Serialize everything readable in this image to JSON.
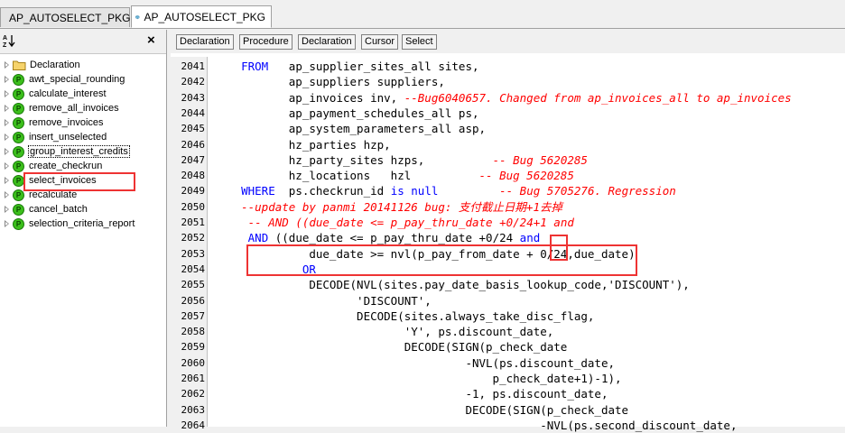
{
  "tabs": [
    {
      "label": "AP_AUTOSELECT_PKG",
      "active": false
    },
    {
      "label": "AP_AUTOSELECT_PKG",
      "active": true
    }
  ],
  "left": {
    "sort_icon": "sort-az-icon",
    "close_glyph": "×",
    "items": [
      {
        "label": "Declaration",
        "icon": "folder-icon"
      },
      {
        "label": "awt_special_rounding",
        "icon": "procedure-icon"
      },
      {
        "label": "calculate_interest",
        "icon": "procedure-icon"
      },
      {
        "label": "remove_all_invoices",
        "icon": "procedure-icon"
      },
      {
        "label": "remove_invoices",
        "icon": "procedure-icon"
      },
      {
        "label": "insert_unselected",
        "icon": "procedure-icon"
      },
      {
        "label": "group_interest_credits",
        "icon": "procedure-icon"
      },
      {
        "label": "create_checkrun",
        "icon": "procedure-icon"
      },
      {
        "label": "select_invoices",
        "icon": "procedure-icon"
      },
      {
        "label": "recalculate",
        "icon": "procedure-icon"
      },
      {
        "label": "cancel_batch",
        "icon": "procedure-icon"
      },
      {
        "label": "selection_criteria_report",
        "icon": "procedure-icon"
      }
    ],
    "procedure_glyph": "P"
  },
  "toolbar": {
    "buttons": [
      "Declaration",
      "Procedure",
      "Declaration",
      "Cursor",
      "Select"
    ]
  },
  "editor": {
    "lines": [
      {
        "n": "2041",
        "parts": [
          [
            "    ",
            "tx"
          ],
          [
            "FROM",
            "kw"
          ],
          [
            "   ap_supplier_sites_all sites,",
            "tx"
          ]
        ]
      },
      {
        "n": "2042",
        "parts": [
          [
            "           ap_suppliers suppliers,",
            "tx"
          ]
        ]
      },
      {
        "n": "2043",
        "parts": [
          [
            "           ap_invoices inv, ",
            "tx"
          ],
          [
            "--Bug6040657. Changed from ap_invoices_all to ap_invoices",
            "cm"
          ]
        ]
      },
      {
        "n": "2044",
        "parts": [
          [
            "           ap_payment_schedules_all ps,",
            "tx"
          ]
        ]
      },
      {
        "n": "2045",
        "parts": [
          [
            "           ap_system_parameters_all asp,",
            "tx"
          ]
        ]
      },
      {
        "n": "2046",
        "parts": [
          [
            "           hz_parties hzp,",
            "tx"
          ]
        ]
      },
      {
        "n": "2047",
        "parts": [
          [
            "           hz_party_sites hzps,          ",
            "tx"
          ],
          [
            "-- Bug 5620285",
            "cm"
          ]
        ]
      },
      {
        "n": "2048",
        "parts": [
          [
            "           hz_locations   hzl          ",
            "tx"
          ],
          [
            "-- Bug 5620285",
            "cm"
          ]
        ]
      },
      {
        "n": "2049",
        "parts": [
          [
            "    ",
            "tx"
          ],
          [
            "WHERE",
            "kw"
          ],
          [
            "  ps.checkrun_id ",
            "tx"
          ],
          [
            "is null",
            "kw"
          ],
          [
            "         ",
            "tx"
          ],
          [
            "-- Bug 5705276. Regression",
            "cm"
          ]
        ]
      },
      {
        "n": "2050",
        "parts": [
          [
            "    ",
            "tx"
          ],
          [
            "--update by panmi 20141126 bug: 支付截止日期+1去掉",
            "cm"
          ]
        ]
      },
      {
        "n": "2051",
        "parts": [
          [
            "     ",
            "tx"
          ],
          [
            "-- AND ((due_date <= p_pay_thru_date +0/24+1 and",
            "cm"
          ]
        ]
      },
      {
        "n": "2052",
        "parts": [
          [
            "     ",
            "tx"
          ],
          [
            "AND",
            "kw"
          ],
          [
            " ((due_date <= p_pay_thru_date +0/24 ",
            "tx"
          ],
          [
            "and",
            "kw"
          ]
        ]
      },
      {
        "n": "2053",
        "parts": [
          [
            "              due_date >= nvl(p_pay_from_date + 0/24,due_date)",
            "tx"
          ]
        ]
      },
      {
        "n": "2054",
        "parts": [
          [
            "             ",
            "tx"
          ],
          [
            "OR",
            "kw"
          ]
        ]
      },
      {
        "n": "2055",
        "parts": [
          [
            "              DECODE(NVL(sites.pay_date_basis_lookup_code,'DISCOUNT'),",
            "tx"
          ]
        ]
      },
      {
        "n": "2056",
        "parts": [
          [
            "                     'DISCOUNT',",
            "tx"
          ]
        ]
      },
      {
        "n": "2057",
        "parts": [
          [
            "                     DECODE(sites.always_take_disc_flag,",
            "tx"
          ]
        ]
      },
      {
        "n": "2058",
        "parts": [
          [
            "                            'Y', ps.discount_date,",
            "tx"
          ]
        ]
      },
      {
        "n": "2059",
        "parts": [
          [
            "                            DECODE(SIGN(p_check_date",
            "tx"
          ]
        ]
      },
      {
        "n": "2060",
        "parts": [
          [
            "                                     -NVL(ps.discount_date,",
            "tx"
          ]
        ]
      },
      {
        "n": "2061",
        "parts": [
          [
            "                                         p_check_date+1)-1),",
            "tx"
          ]
        ]
      },
      {
        "n": "2062",
        "parts": [
          [
            "                                     -1, ps.discount_date,",
            "tx"
          ]
        ]
      },
      {
        "n": "2063",
        "parts": [
          [
            "                                     DECODE(SIGN(p_check_date",
            "tx"
          ]
        ]
      },
      {
        "n": "2064",
        "parts": [
          [
            "                                                -NVL(ps.second_discount_date,",
            "tx"
          ]
        ]
      }
    ]
  },
  "colors": {
    "keyword": "#0000ff",
    "comment": "#ff0000",
    "highlight_box": "#e33333",
    "procedure_icon": "#3cbf1c"
  }
}
